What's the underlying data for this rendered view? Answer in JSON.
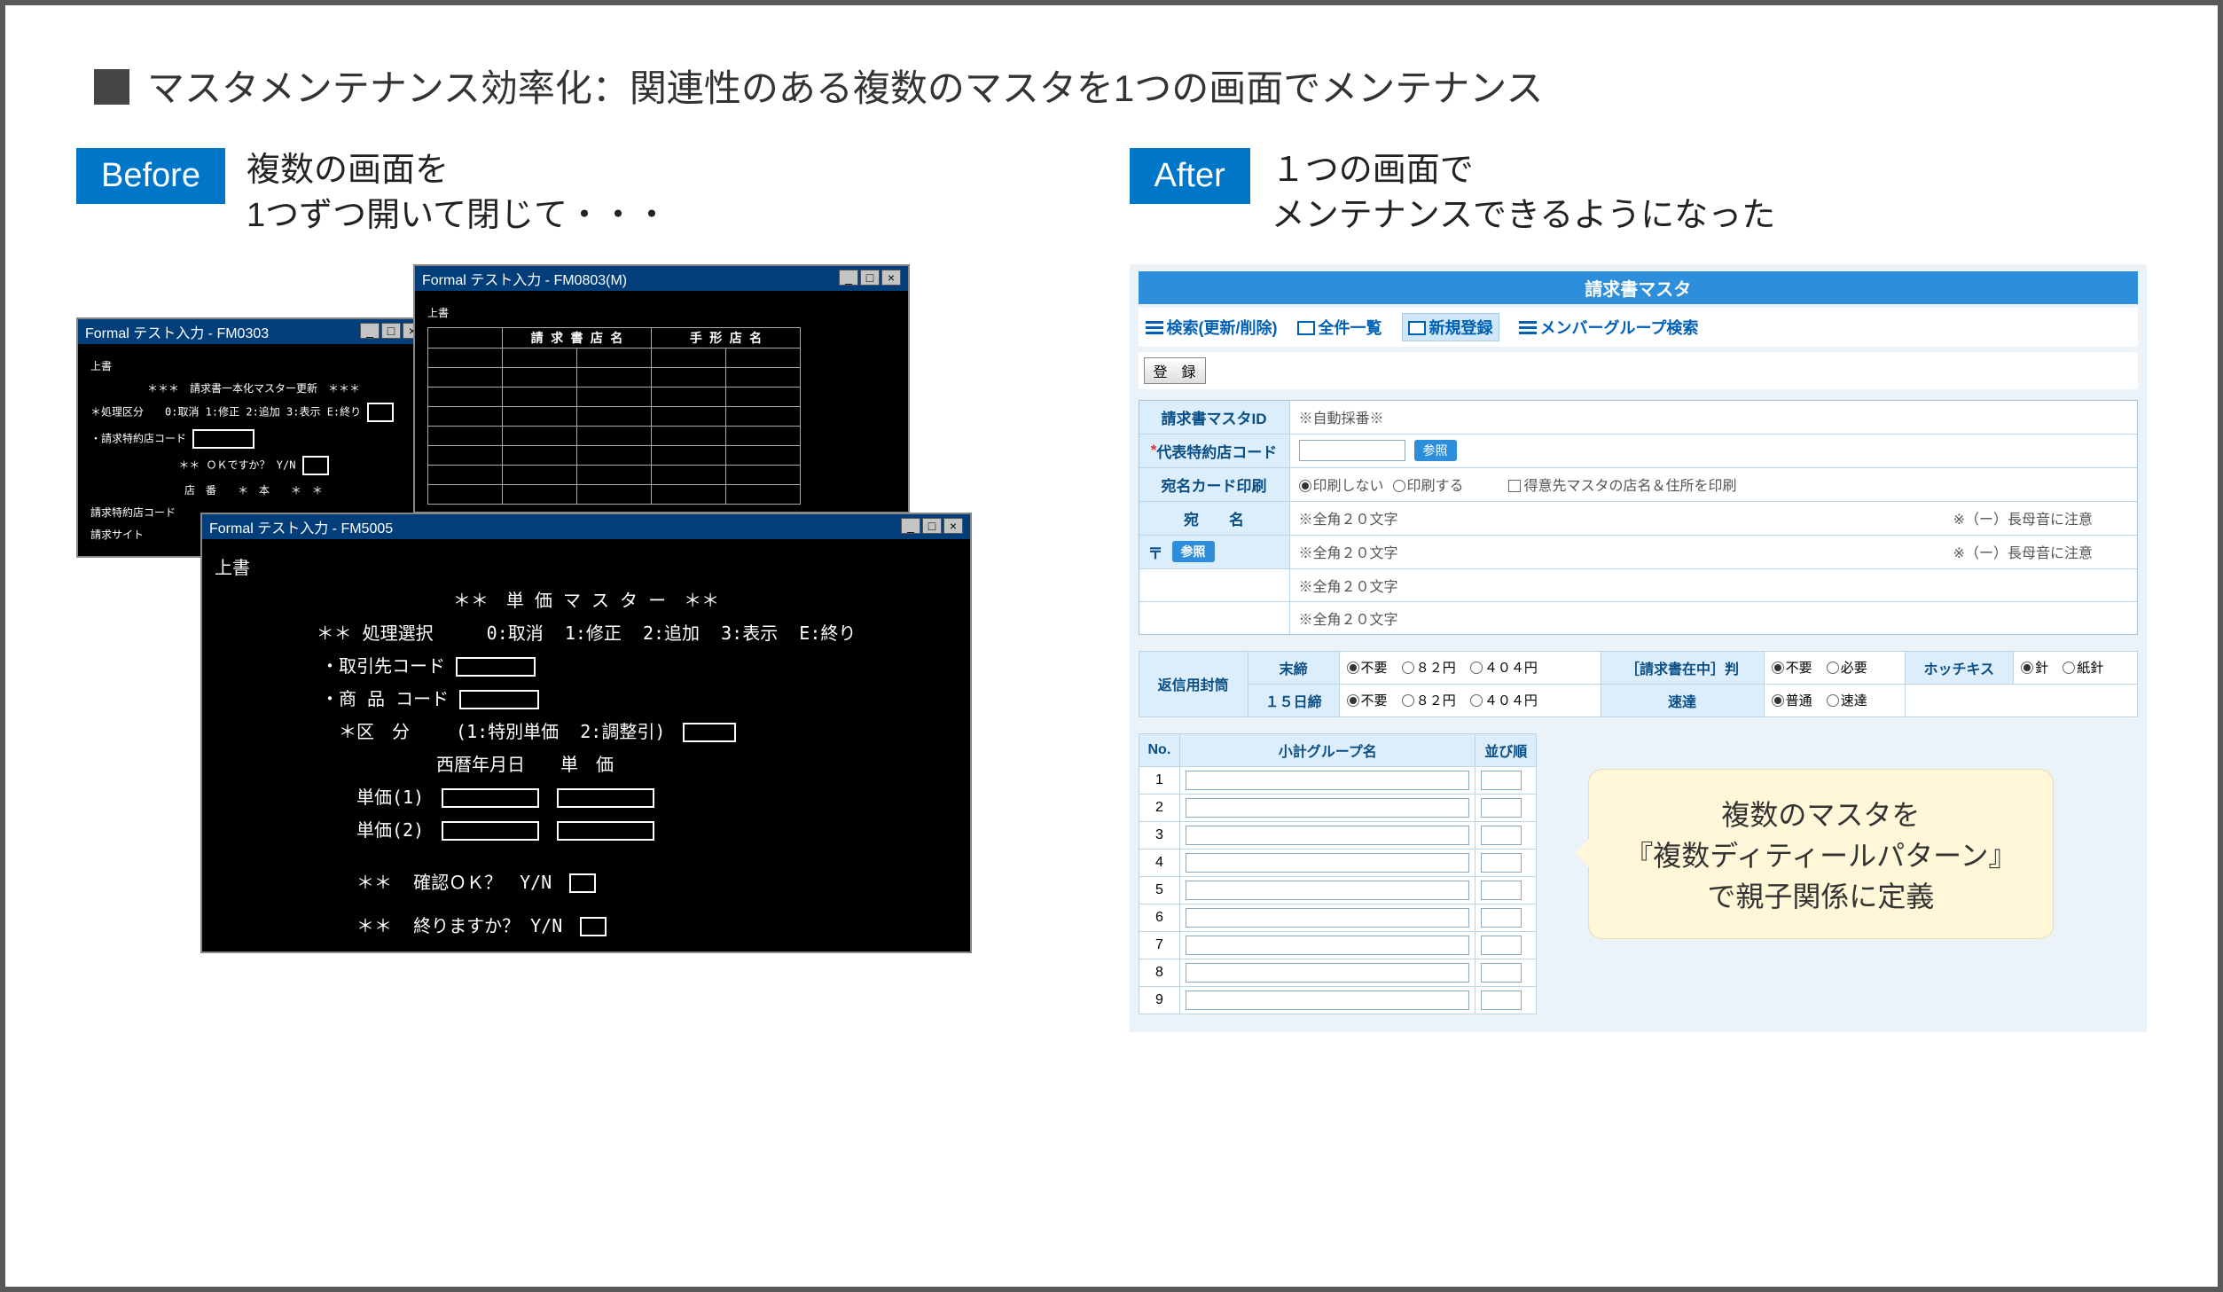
{
  "page_title": "マスタメンテナンス効率化：関連性のある複数のマスタを1つの画面でメンテナンス",
  "before": {
    "pill": "Before",
    "subhead": "複数の画面を\n1つずつ開いて閉じて・・・",
    "win1": {
      "title": "Formal テスト入力 - FM0303",
      "overwrite": "上書",
      "heading": "＊＊＊　請求書一本化マスター更新　＊＊＊",
      "proc": "＊処理区分　　0:取消 1:修正 2:追加 3:表示 E:終り",
      "partner": "・請求特約店コード",
      "ok": "＊＊ ＯＫですか？ Y/N",
      "labels": "店　番　　＊　本　　＊　＊",
      "labels2": "請求特約店コード",
      "labels3": "請求サイト"
    },
    "win2": {
      "title": "Formal テスト入力 - FM0803(M)",
      "overwrite": "上書",
      "col1": "請 求 書 店 名",
      "col2": "手 形 店 名"
    },
    "win3": {
      "title": "Formal テスト入力 - FM5005",
      "overwrite": "上書",
      "heading": "＊＊　単 価 マ ス タ ー　＊＊",
      "proc": "＊＊ 処理選択　　　0:取消  1:修正  2:追加  3:表示  E:終り",
      "partner": "・取引先コード",
      "item": "・商 品 コード",
      "cat": "＊区　分　　 (1:特別単価  2:調整引)",
      "datehdr": "西暦年月日　　単　価",
      "u1": "単価(1)",
      "u2": "単価(2)",
      "confirm": "＊＊  確認ＯＫ？　Y/N",
      "end": "＊＊  終りますか？ Y/N"
    }
  },
  "after": {
    "pill": "After",
    "subhead": "１つの画面で\nメンテナンスできるようになった",
    "title": "請求書マスタ",
    "tabs": {
      "search": "検索(更新/削除)",
      "all": "全件一覧",
      "new": "新規登録",
      "member": "メンバーグループ検索"
    },
    "register_btn": "登　録",
    "rows": {
      "id_label": "請求書マスタID",
      "id_note": "※自動採番※",
      "shop_label": "代表特約店コード",
      "sanshou": "参照",
      "print_label": "宛名カード印刷",
      "print_no": "印刷しない",
      "print_yes": "印刷する",
      "print_chk": "得意先マスタの店名＆住所を印刷",
      "atena": "宛　　名",
      "note_full20": "※全角２０文字",
      "note_dash": "※（ー）長母音に注意",
      "zip": "〒"
    },
    "envelope": {
      "group_label": "返信用封筒",
      "mattan": "末締",
      "d15": "１５日締",
      "fuyo": "不要",
      "y82": "８２円",
      "y404": "４０４円",
      "stamp_label": "［請求書在中］判",
      "hitsuyo": "必要",
      "sokutatsu_label": "速達",
      "futsu": "普通",
      "sokutatsu": "速達",
      "hotchkiss_label": "ホッチキス",
      "hari": "針",
      "kamihari": "紙針"
    },
    "grid": {
      "no": "No.",
      "group": "小計グループ名",
      "order": "並び順",
      "rows": [
        1,
        2,
        3,
        4,
        5,
        6,
        7,
        8,
        9
      ]
    },
    "callout": "複数のマスタを\n『複数ディティールパターン』\nで親子関係に定義"
  }
}
